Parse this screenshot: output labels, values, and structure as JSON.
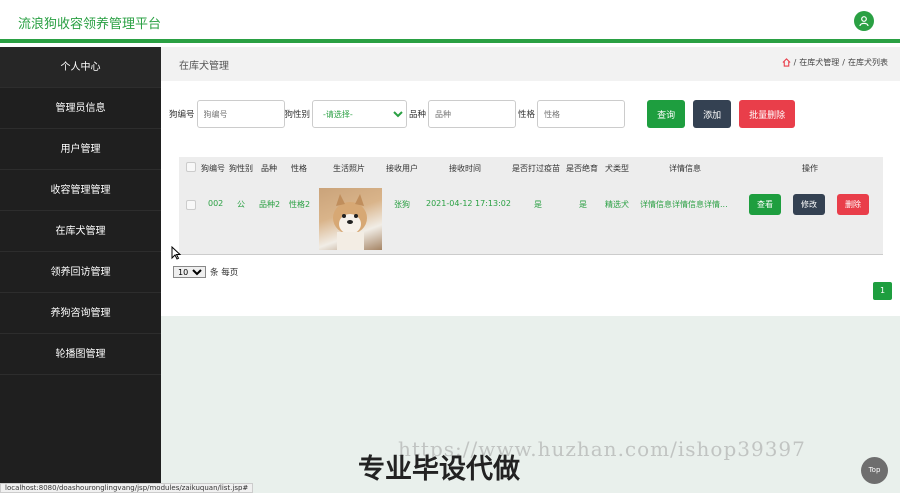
{
  "app": {
    "title": "流浪狗收容领养管理平台"
  },
  "sidebar": {
    "items": [
      {
        "label": "个人中心"
      },
      {
        "label": "管理员信息"
      },
      {
        "label": "用户管理"
      },
      {
        "label": "收容管理管理"
      },
      {
        "label": "在库犬管理"
      },
      {
        "label": "领养回访管理"
      },
      {
        "label": "养狗咨询管理"
      },
      {
        "label": "轮播图管理"
      }
    ]
  },
  "page": {
    "title": "在库犬管理",
    "breadcrumb": [
      "在库犬管理",
      "在库犬列表"
    ],
    "breadcrumb_sep": "/"
  },
  "search": {
    "fields": [
      {
        "label": "狗编号",
        "placeholder": "狗编号"
      },
      {
        "label": "狗性别",
        "value": "-请选择-"
      },
      {
        "label": "品种",
        "placeholder": "品种"
      },
      {
        "label": "性格",
        "placeholder": "性格"
      }
    ],
    "buttons": {
      "query": "查询",
      "add": "添加",
      "batch_delete": "批量删除"
    }
  },
  "table": {
    "headers": [
      "狗编号",
      "狗性别",
      "品种",
      "性格",
      "生活照片",
      "接收用户",
      "接收时间",
      "是否打过疫苗",
      "是否绝育",
      "犬类型",
      "详情信息",
      "操作"
    ],
    "rows": [
      {
        "dog_no": "002",
        "gender": "公",
        "breed": "品种2",
        "temperament": "性格2",
        "receiver": "张狗",
        "receive_time": "2021-04-12 17:13:02",
        "vaccinated": "是",
        "neutered": "是",
        "dog_type": "精选犬",
        "details": "详情信息详情信息详情...",
        "actions": {
          "view": "查看",
          "edit": "修改",
          "delete": "删除"
        }
      }
    ]
  },
  "pagination": {
    "page_size": "10",
    "per_page_label": "条 每页",
    "current_page": "1"
  },
  "overlay": {
    "watermark_url": "https://www.huzhan.com/ishop39397",
    "watermark_text": "专业毕设代做",
    "status_url": "localhost:8080/doashouronglingvang/jsp/modules/zaikuquan/list.jsp#",
    "top_button": "Top"
  },
  "colors": {
    "brand_green": "#2aa043",
    "sidebar_bg": "#1f1f1f",
    "danger": "#e93e4a",
    "dark_button": "#344152"
  }
}
